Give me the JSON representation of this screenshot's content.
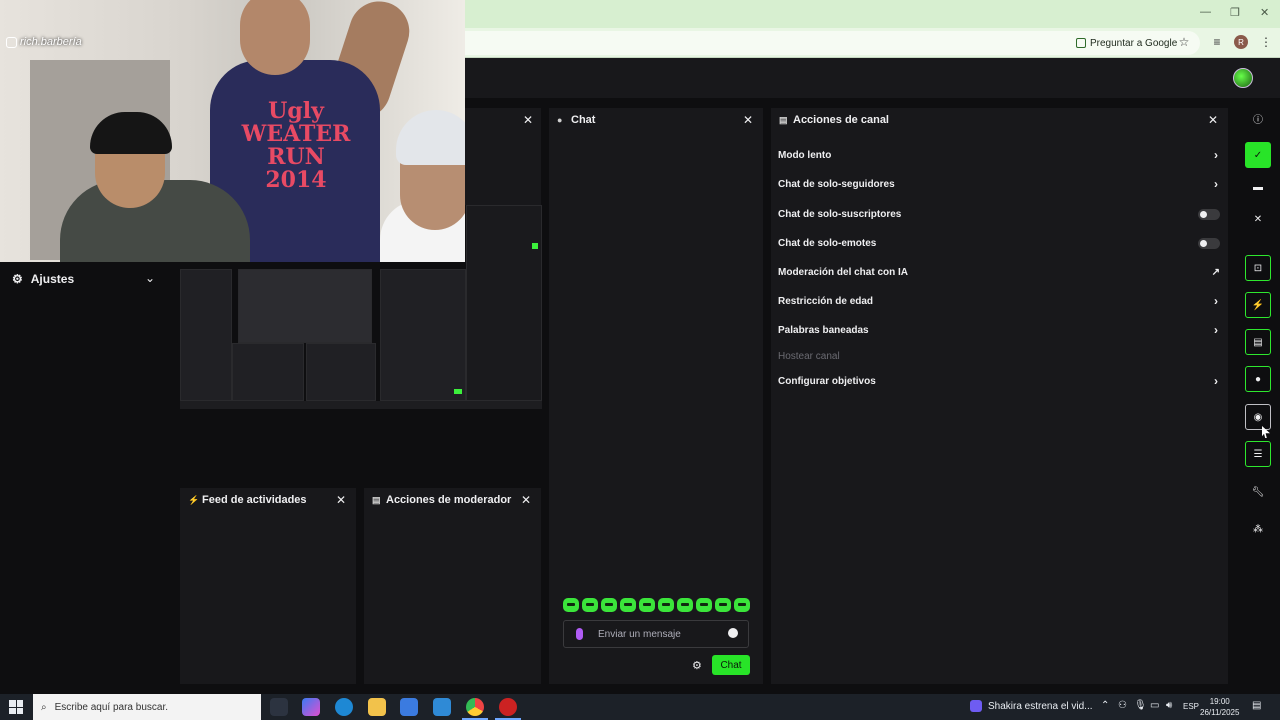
{
  "browser": {
    "ask_google": "Preguntar a Google",
    "profile_letter": "R"
  },
  "webcam": {
    "handle": "rich.barbería",
    "sweater_line1": "Ugly",
    "sweater_line2": "WEATER",
    "sweater_line3": "RUN",
    "sweater_line4": "2014"
  },
  "ajustes": {
    "title": "Ajustes"
  },
  "panels": {
    "chat_title": "Chat",
    "channel_title": "Acciones de canal",
    "feed_title": "Feed de actividades",
    "mod_title": "Acciones de moderador"
  },
  "chat": {
    "placeholder": "Enviar un mensaje",
    "send_label": "Chat"
  },
  "channel_actions": [
    {
      "label": "Modo lento",
      "kind": "chevron"
    },
    {
      "label": "Chat de solo-seguidores",
      "kind": "chevron"
    },
    {
      "label": "Chat de solo-suscriptores",
      "kind": "toggle"
    },
    {
      "label": "Chat de solo-emotes",
      "kind": "toggle"
    },
    {
      "label": "Moderación del chat con IA",
      "kind": "external"
    },
    {
      "label": "Restricción de edad",
      "kind": "chevron"
    },
    {
      "label": "Palabras baneadas",
      "kind": "chevron"
    },
    {
      "label": "Hostear canal",
      "kind": "disabled"
    },
    {
      "label": "Configurar objetivos",
      "kind": "chevron"
    }
  ],
  "rail_icons": [
    "info-icon",
    "check-icon",
    "layout-icon",
    "close-icon",
    "focus-icon",
    "lightning-icon",
    "document-icon",
    "chat-bubble-icon",
    "broadcast-icon",
    "stack-icon",
    "wrench-icon",
    "nodes-icon"
  ],
  "taskbar": {
    "search_placeholder": "Escribe aquí para buscar.",
    "news": "Shakira estrena el vid...",
    "lang": "ESP",
    "time": "19:00",
    "date": "26/11/2025"
  },
  "colors": {
    "accent": "#28e428",
    "bg": "#0e0e10",
    "panel": "#18181b"
  }
}
